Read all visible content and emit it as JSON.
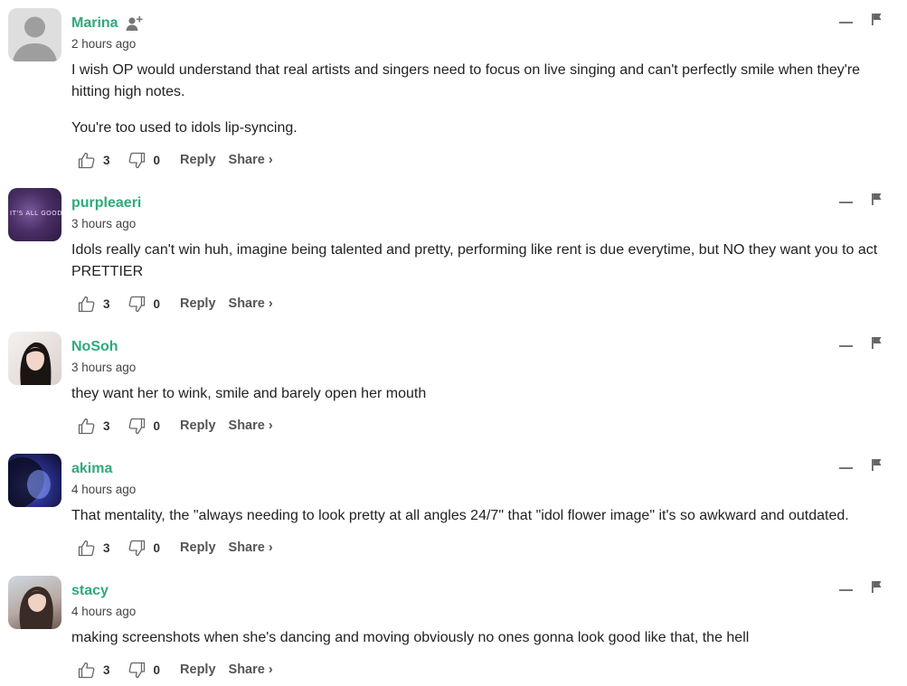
{
  "comments": [
    {
      "username": "Marina",
      "time": "2 hours ago",
      "paragraphs": [
        "I wish OP would understand that real artists and singers need to focus on live singing and can't perfectly smile when they're hitting high notes.",
        "You're too used to idols lip-syncing."
      ],
      "upvotes": "3",
      "downvotes": "0",
      "reply": "Reply",
      "share": "Share ›",
      "avatar": "default-avatar-icon"
    },
    {
      "username": "purpleaeri",
      "time": "3 hours ago",
      "paragraphs": [
        "Idols really can't win huh, imagine being talented and pretty, performing like rent is due everytime, but NO they want you to act PRETTIER"
      ],
      "upvotes": "3",
      "downvotes": "0",
      "reply": "Reply",
      "share": "Share ›",
      "avatar_text": "IT'S ALL GOOD"
    },
    {
      "username": "NoSoh",
      "time": "3 hours ago",
      "paragraphs": [
        "they want her to wink, smile and barely open her mouth"
      ],
      "upvotes": "3",
      "downvotes": "0",
      "reply": "Reply",
      "share": "Share ›"
    },
    {
      "username": "akima",
      "time": "4 hours ago",
      "paragraphs": [
        "That mentality, the \"always needing to look pretty at all angles 24/7\" that \"idol flower image\" it's so awkward and outdated."
      ],
      "upvotes": "3",
      "downvotes": "0",
      "reply": "Reply",
      "share": "Share ›"
    },
    {
      "username": "stacy",
      "time": "4 hours ago",
      "paragraphs": [
        "making screenshots when she's dancing and moving obviously no ones gonna look good like that, the hell"
      ],
      "upvotes": "3",
      "downvotes": "0",
      "reply": "Reply",
      "share": "Share ›"
    }
  ],
  "colors": {
    "username": "#2eaa7b",
    "text": "#222222",
    "icon": "#666666"
  }
}
